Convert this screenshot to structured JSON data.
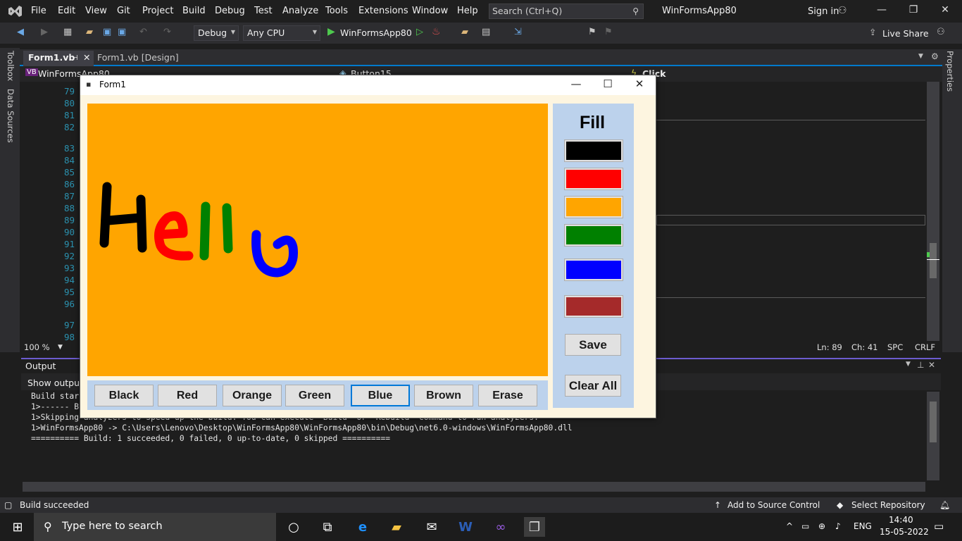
{
  "menu": [
    "File",
    "Edit",
    "View",
    "Git",
    "Project",
    "Build",
    "Debug",
    "Test",
    "Analyze",
    "Tools",
    "Extensions",
    "Window",
    "Help"
  ],
  "search": {
    "placeholder": "Search (Ctrl+Q)"
  },
  "solution_name": "WinFormsApp80",
  "sign_in": "Sign in",
  "toolbar": {
    "config": "Debug",
    "platform": "Any CPU",
    "start_target": "WinFormsApp80",
    "live_share": "Live Share"
  },
  "side_tabs": {
    "toolbox": "Toolbox",
    "data_sources": "Data Sources",
    "properties": "Properties"
  },
  "doc_tabs": [
    "Form1.vb",
    "Form1.vb [Design]"
  ],
  "nav": {
    "project": "WinFormsApp80",
    "member": "Button15",
    "event": "Click"
  },
  "line_numbers": [
    "79",
    "80",
    "81",
    "82",
    "83",
    "84",
    "85",
    "86",
    "87",
    "88",
    "89",
    "90",
    "91",
    "92",
    "93",
    "94",
    "95",
    "96",
    "97",
    "98"
  ],
  "editor_status": {
    "zoom": "100 %",
    "ln": "Ln: 89",
    "ch": "Ch: 41",
    "spc": "SPC",
    "crlf": "CRLF"
  },
  "output": {
    "title": "Output",
    "show_from": "Show output f",
    "lines": [
      "Build star",
      "1>------ B",
      "1>Skipping analyzers to speed up the build. You can execute 'Build' or 'Rebuild' command to run analyzers.",
      "1>WinFormsApp80 -> C:\\Users\\Lenovo\\Desktop\\WinFormsApp80\\WinFormsApp80\\bin\\Debug\\net6.0-windows\\WinFormsApp80.dll",
      "========== Build: 1 succeeded, 0 failed, 0 up-to-date, 0 skipped =========="
    ]
  },
  "status": {
    "build": "Build succeeded",
    "source_control": "Add to Source Control",
    "repo": "Select Repository"
  },
  "taskbar": {
    "search_placeholder": "Type here to search",
    "lang": "ENG",
    "time": "14:40",
    "date": "15-05-2022"
  },
  "form": {
    "title": "Form1",
    "canvas_color": "#FFA500",
    "panel_color": "#BCD2EC",
    "bottom_buttons": [
      "Black",
      "Red",
      "Orange",
      "Green",
      "Blue",
      "Brown",
      "Erase"
    ],
    "active_button": "Blue",
    "fill_label": "Fill",
    "swatches": [
      "#000000",
      "#FF0000",
      "#FFA500",
      "#008000",
      "#0000FF",
      "#A52A2A"
    ],
    "save_label": "Save",
    "clear_label": "Clear All"
  }
}
